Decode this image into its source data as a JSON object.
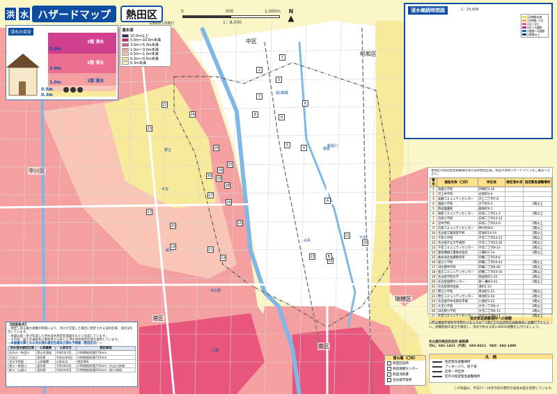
{
  "title": {
    "box1": "洪",
    "box2": "水",
    "main": "ハザードマップ",
    "ward": "熱田区"
  },
  "revision": "令和6年1月発行",
  "main_map": {
    "scale": {
      "zero": "0",
      "mid": "500",
      "end": "1,000m",
      "ratio": "1：8,000"
    },
    "north": "N",
    "districts": [
      "中区",
      "昭和区",
      "中川区",
      "瑞穂区",
      "港区",
      "南区"
    ],
    "river_labels": [
      "堀川",
      "新堀川"
    ],
    "road_labels": [
      "大宝",
      "野立",
      "船方",
      "白鳥",
      "高蔵",
      "旗屋",
      "千年",
      "日比野",
      "六番"
    ],
    "shelter_numbers": [
      "1",
      "2",
      "3",
      "4",
      "5",
      "6",
      "7",
      "8",
      "9",
      "10",
      "11",
      "12",
      "13",
      "14",
      "15",
      "16",
      "17",
      "18",
      "19",
      "20",
      "21",
      "22",
      "23",
      "24",
      "25",
      "26",
      "27",
      "28",
      "29",
      "30",
      "A",
      "B"
    ]
  },
  "depth_panel": {
    "header": "浸水の目安",
    "levels": [
      "5.0m",
      "3.0m",
      "1.0m",
      "0.5m",
      "0.3m"
    ],
    "floors": [
      "3階 浸水",
      "2階 浸水",
      "1階 浸水"
    ]
  },
  "depth_legend": {
    "header": "浸水深",
    "rows": [
      {
        "label": "10.0m以上",
        "color": "#2f2460"
      },
      {
        "label": "5.0m〜10.0m未満",
        "color": "#c71d7a"
      },
      {
        "label": "3.0m〜5.0m未満",
        "color": "#e8557d"
      },
      {
        "label": "1.0m〜3.0m未満",
        "color": "#f4a0a0"
      },
      {
        "label": "0.5m〜1.0m未満",
        "color": "#f8c5b6"
      },
      {
        "label": "0.3m〜0.5m未満",
        "color": "#f7ea9b"
      },
      {
        "label": "0.3m未満",
        "color": "#fbf6c8"
      }
    ]
  },
  "inset": {
    "title": "浸水継続時間図",
    "scale": "1：25,000",
    "legend": [
      {
        "label": "12時間未満",
        "color": "#f5d84a"
      },
      {
        "label": "12時間〜1日",
        "color": "#f3a83b"
      },
      {
        "label": "1日〜3日",
        "color": "#e8557d"
      },
      {
        "label": "3日〜1週間",
        "color": "#c71d7a"
      },
      {
        "label": "1週間〜2週間",
        "color": "#2563c2"
      },
      {
        "label": "2週間以上",
        "color": "#0d3a86"
      }
    ]
  },
  "shelter_table": {
    "intro": "本地区の指定緊急避難場所等の浸水想定区域。各区の洪水ハザードマップをご確認ください。",
    "headers": [
      "番号",
      "施設名称（〇印）",
      "所在地",
      "想定浸水深",
      "指定緊急避難場所"
    ],
    "rows": [
      {
        "no": "1",
        "name": "高蔵小学校",
        "addr": "四條町3-16",
        "depth": "",
        "note": ""
      },
      {
        "no": "2",
        "name": "沢上中学校",
        "addr": "古新町4-4",
        "depth": "",
        "note": ""
      },
      {
        "no": "3",
        "name": "高蔵コミュニティセンター",
        "addr": "沢上二丁目7-6",
        "depth": "",
        "note": ""
      },
      {
        "no": "4",
        "name": "旗屋小学校",
        "addr": "沢下町9-3",
        "depth": "",
        "note": "2階以上"
      },
      {
        "no": "5",
        "name": "熱田図書館",
        "addr": "森後町9-1",
        "depth": "",
        "note": ""
      },
      {
        "no": "6",
        "name": "旗屋コミュニティセンター",
        "addr": "白鳥二丁目11-3",
        "depth": "",
        "note": "2階以上"
      },
      {
        "no": "7",
        "name": "白鳥小学校",
        "addr": "白鳥二丁目13-12",
        "depth": "",
        "note": ""
      },
      {
        "no": "8",
        "name": "宮中学校",
        "addr": "白鳥二丁目15-6",
        "depth": "",
        "note": "2階以上"
      },
      {
        "no": "9",
        "name": "白鳥コミュニティセンター",
        "addr": "神戸町601",
        "depth": "",
        "note": "2階以上"
      },
      {
        "no": "10",
        "name": "名古屋工業高等学校",
        "addr": "花表町19-14",
        "depth": "",
        "note": "2階以上"
      },
      {
        "no": "11",
        "name": "千年小学校",
        "addr": "千年二丁目13-21",
        "depth": "",
        "note": "2階以上"
      },
      {
        "no": "12",
        "name": "名古屋市立大学病院",
        "addr": "千年二丁目15-26",
        "depth": "",
        "note": "2階以上"
      },
      {
        "no": "13",
        "name": "千年コミュニティセンター",
        "addr": "千年二丁目9-23",
        "depth": "",
        "note": "2階以上"
      },
      {
        "no": "14",
        "name": "愛知機械工業株式会社",
        "addr": "三番町2-14",
        "depth": "",
        "note": "2階以上"
      },
      {
        "no": "15",
        "name": "株式会社加藤製作所",
        "addr": "四番二丁目19-8",
        "depth": "",
        "note": ""
      },
      {
        "no": "16",
        "name": "船方小学校",
        "addr": "四番二丁目10-43",
        "depth": "",
        "note": "2階以上"
      },
      {
        "no": "17",
        "name": "日比野中学校",
        "addr": "四番二丁目4-60",
        "depth": "",
        "note": "2階以上"
      },
      {
        "no": "18",
        "name": "船方コミュニティセンター",
        "addr": "四番二丁目10-16",
        "depth": "",
        "note": "2階以上"
      },
      {
        "no": "19",
        "name": "名古屋学院大学",
        "addr": "熱田西町1-25",
        "depth": "",
        "note": "2階以上"
      },
      {
        "no": "20",
        "name": "名古屋国際センター",
        "addr": "南一番町4-41",
        "depth": "",
        "note": "2階以上"
      },
      {
        "no": "21",
        "name": "名古屋港湾会館",
        "addr": "港町1-25",
        "depth": "",
        "note": ""
      },
      {
        "no": "22",
        "name": "野立小学校",
        "addr": "青池町2-21",
        "depth": "",
        "note": "2階以上"
      },
      {
        "no": "23",
        "name": "野立コミュニティセンター",
        "addr": "青池町3-43",
        "depth": "",
        "note": "2階以上"
      },
      {
        "no": "24",
        "name": "名古屋市中央卸売市場",
        "addr": "川並町2-22",
        "depth": "",
        "note": "2階以上"
      },
      {
        "no": "25",
        "name": "大宝小学校",
        "addr": "大宝一丁目4-4",
        "depth": "",
        "note": "2階以上"
      },
      {
        "no": "26",
        "name": "日比野小学校",
        "addr": "大宝二丁目4-15",
        "depth": "",
        "note": "2階以上"
      },
      {
        "no": "27",
        "name": "大宝コミュニティセンター",
        "addr": "大宝三丁目8-11",
        "depth": "",
        "note": "2階以上"
      },
      {
        "no": "28",
        "name": "名古屋市立熱田高校",
        "addr": "一番一丁目6-5",
        "depth": "",
        "note": "2階以上"
      }
    ]
  },
  "notice": {
    "title": "指定緊急避難場所への避難",
    "text": "○印は施設が浸水する恐れがあるため、2階以上の指定緊急避難場所に避難してください。避難経路の安全を確認し、浸水が始まる前に早めの避難を心がけましょう。"
  },
  "contact": {
    "org": "名古屋市熱田区役所 総務課",
    "tel": "TEL：681-1431（代表） 683-9411",
    "fax": "FAX：682-1496"
  },
  "map_legend": {
    "title": "凡　例",
    "items": [
      "指定緊急避難場所",
      "アンダーパス、地下道",
      "区界・学区界",
      "区外の指定緊急避難場所"
    ]
  },
  "gov_legend": {
    "title": "官公署（〇印）",
    "items": [
      "熱田区役所",
      "熱田保健センター",
      "熱田消防署",
      "名古屋市役所"
    ]
  },
  "notes_box": {
    "title": "【前提条件】",
    "lines": [
      "・想定し得る最大規模の降雨により、河川が氾濫した場合に想定される浸水区域、浸水深を示しています。",
      "・本図は国・県が作成した洪水浸水想定区域図をもとに作成しています。",
      "・その他、国土交通省及び愛知県が公表した洪水浸水想定区域を使用しています。"
    ],
    "sub": "―本図書の算となる洪水浸水想定区域及び浸水予想図（熱田区内）―",
    "headers": [
      "洪水浸水想定区域",
      "公表機関",
      "公表年月",
      "想定降雨"
    ],
    "rows": [
      [
        "庄内川・矢田川",
        "国土交通省",
        "令和2年3月",
        "24時間総雨量578mm"
      ],
      [
        "天白川",
        "愛知県",
        "令和元年6月",
        "24時間総雨量735mm"
      ],
      [
        "浸水予想図",
        "公表機関",
        "公表年月",
        "想定降雨"
      ],
      [
        "堀川・新堀川",
        "愛知県",
        "令和3年6月",
        "24時間総雨量735mm（天白川流域）"
      ],
      [
        "新川・山崎川",
        "愛知県",
        "令和3年6月",
        "24時間総雨量834mm（新川流域）"
      ]
    ]
  },
  "footer": "この地図は、平成27・28年作成の都市計画基本図を使用しています。"
}
